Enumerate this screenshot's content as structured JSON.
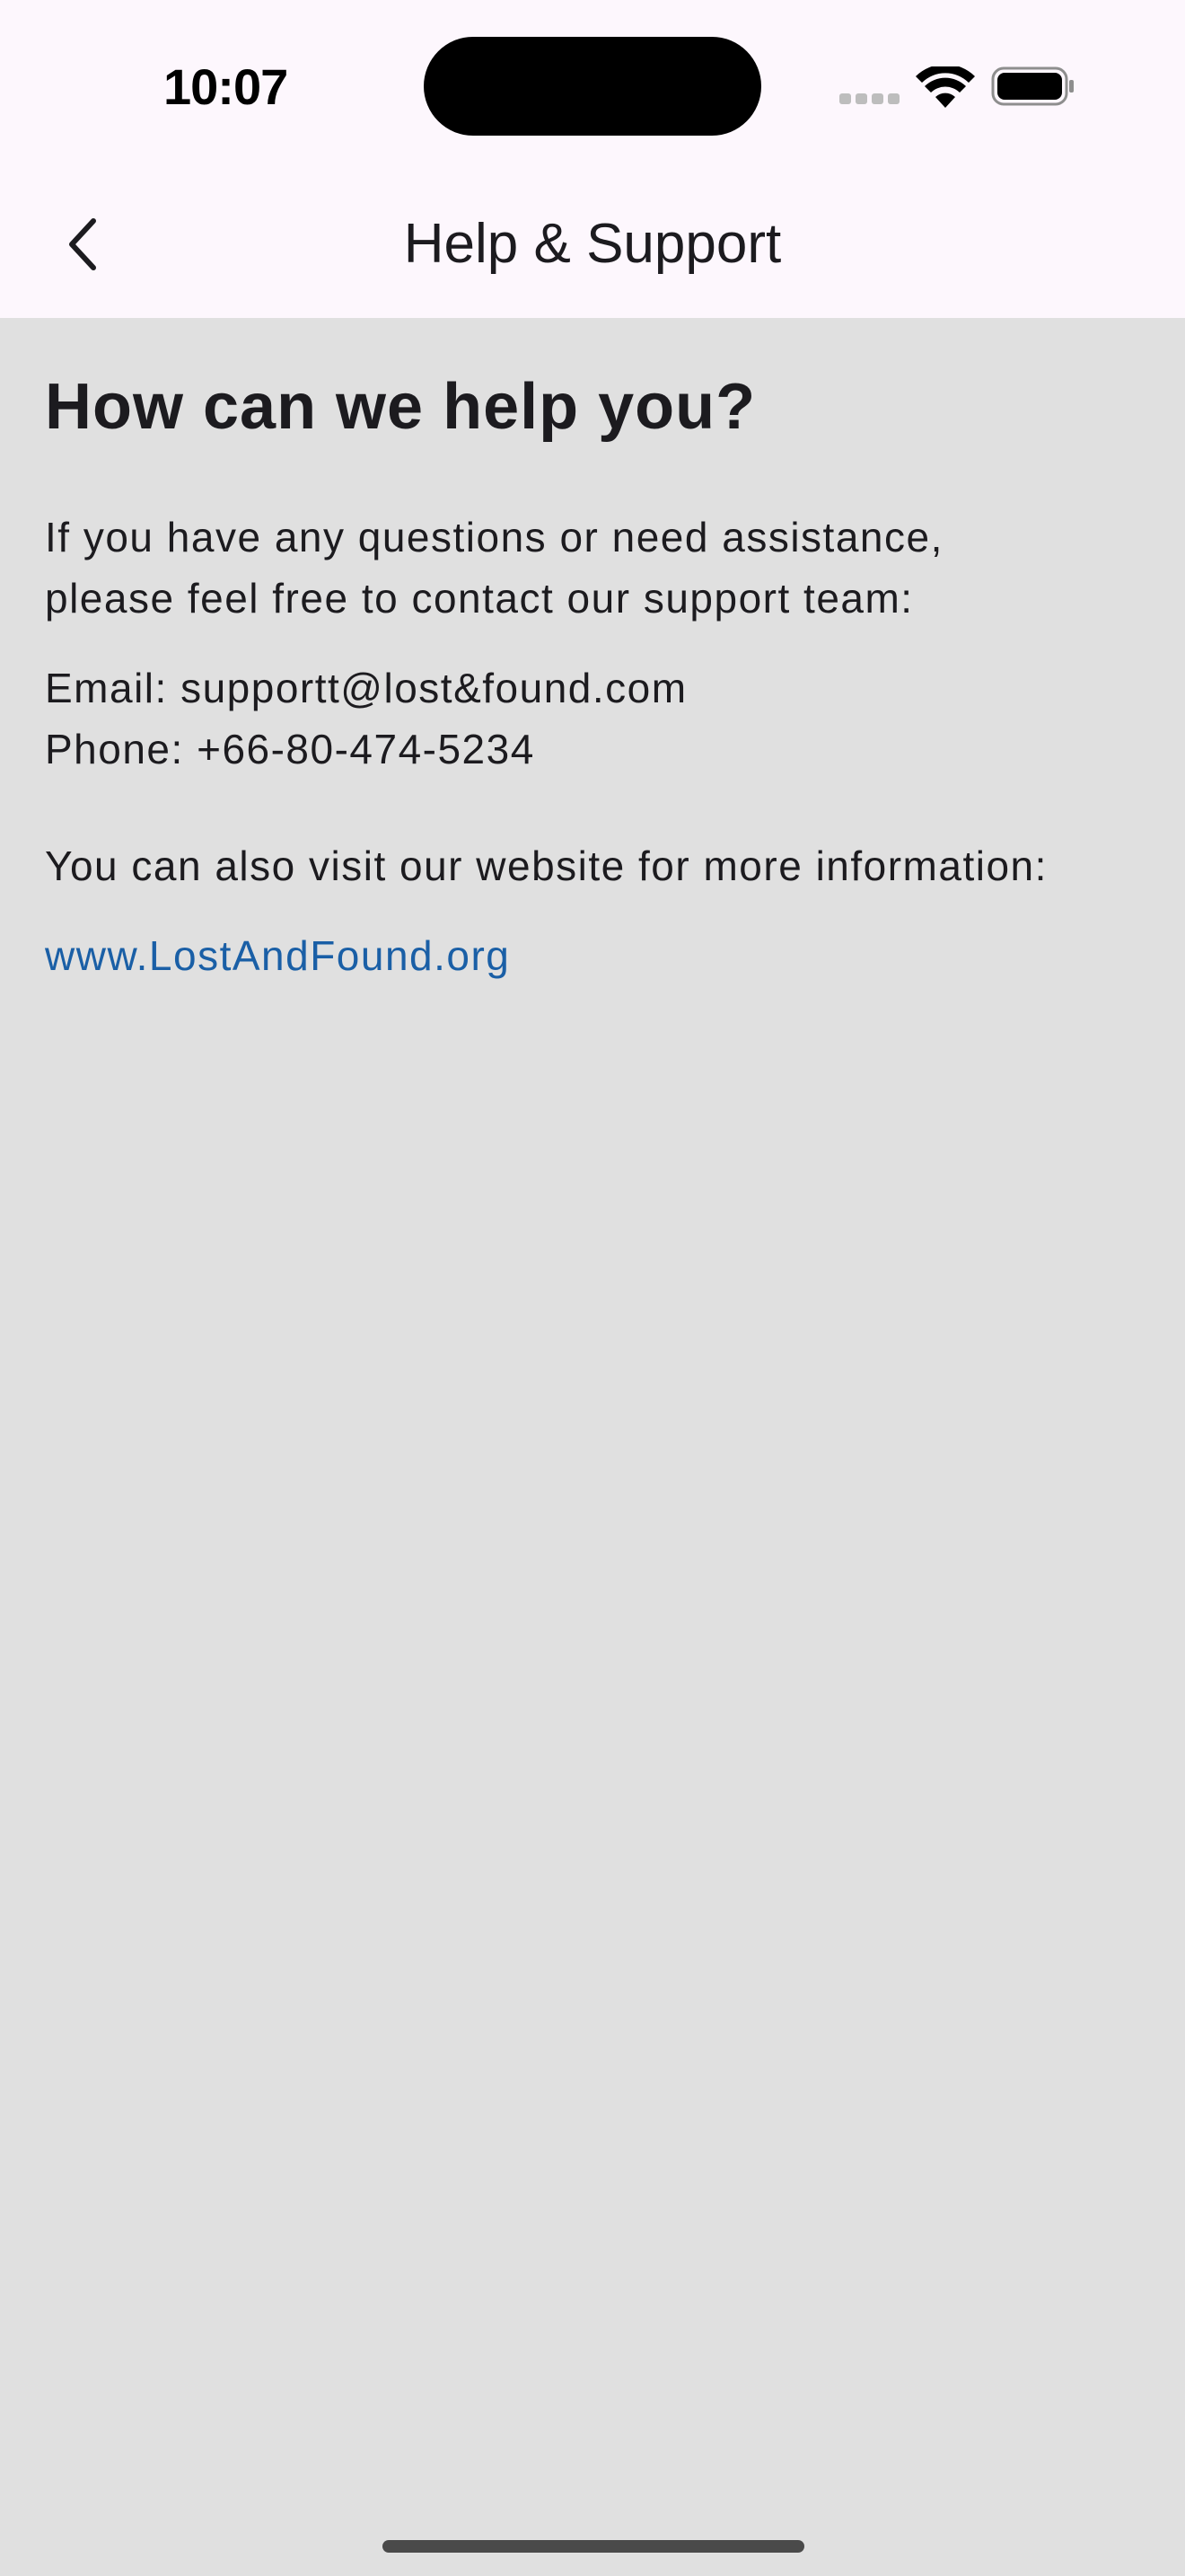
{
  "status_bar": {
    "time": "10:07"
  },
  "app_bar": {
    "title": "Help & Support",
    "back_icon": "chevron-left-icon"
  },
  "content": {
    "heading": "How can we help you?",
    "intro_line1": "If you have any questions or need assistance,",
    "intro_line2": "please feel free to contact our support team:",
    "email_line": "Email: supportt@lost&found.com",
    "phone_line": "Phone: +66-80-474-5234",
    "visit_text": "You can also visit our website for more information:",
    "website_link": "www.LostAndFound.org"
  },
  "colors": {
    "background": "#e0e0e0",
    "app_bar": "#fdf7fd",
    "link": "#1a5fa6",
    "text": "#1c1b1f"
  }
}
